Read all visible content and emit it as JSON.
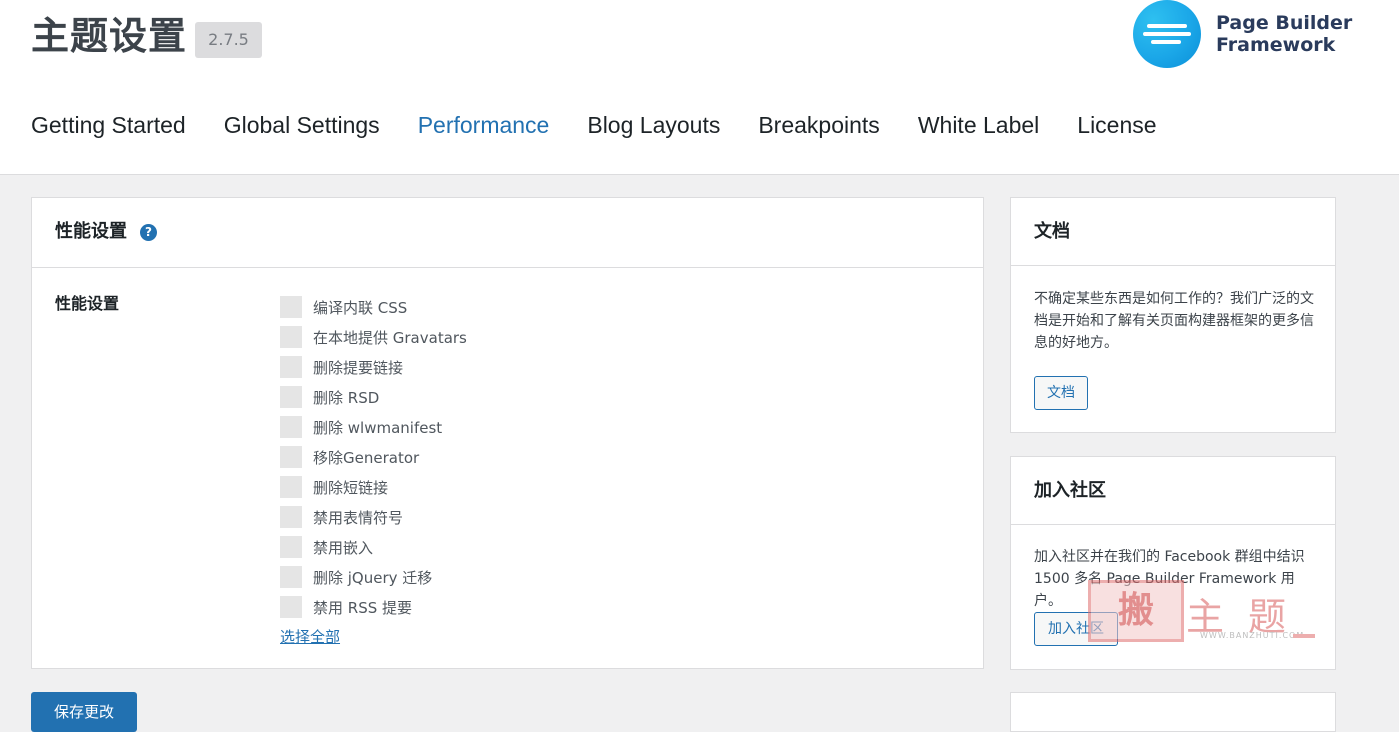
{
  "header": {
    "title": "主题设置",
    "version": "2.7.5",
    "logo": {
      "line1": "Page Builder",
      "line2": "Framework",
      "icon": "pbf-logo-icon",
      "color": "#1ba7e8"
    }
  },
  "tabs": [
    {
      "label": "Getting Started",
      "active": false
    },
    {
      "label": "Global Settings",
      "active": false
    },
    {
      "label": "Performance",
      "active": true
    },
    {
      "label": "Blog Layouts",
      "active": false
    },
    {
      "label": "Breakpoints",
      "active": false
    },
    {
      "label": "White Label",
      "active": false
    },
    {
      "label": "License",
      "active": false
    }
  ],
  "performance": {
    "title": "性能设置",
    "help_icon": "?",
    "field_label": "性能设置",
    "options": [
      {
        "label": "编译内联 CSS",
        "checked": false
      },
      {
        "label": "在本地提供 Gravatars",
        "checked": false
      },
      {
        "label": "删除提要链接",
        "checked": false
      },
      {
        "label": "删除 RSD",
        "checked": false
      },
      {
        "label": "删除 wlwmanifest",
        "checked": false
      },
      {
        "label": "移除Generator",
        "checked": false
      },
      {
        "label": "删除短链接",
        "checked": false
      },
      {
        "label": "禁用表情符号",
        "checked": false
      },
      {
        "label": "禁用嵌入",
        "checked": false
      },
      {
        "label": "删除 jQuery 迁移",
        "checked": false
      },
      {
        "label": "禁用 RSS 提要",
        "checked": false
      }
    ],
    "select_all": "选择全部",
    "save_button": "保存更改"
  },
  "sidebar": {
    "docs": {
      "title": "文档",
      "text": "不确定某些东西是如何工作的？我们广泛的文档是开始和了解有关页面构建器框架的更多信息的好地方。",
      "button": "文档"
    },
    "community": {
      "title": "加入社区",
      "text": "加入社区并在我们的 Facebook 群组中结识 1500 多名 Page Builder Framework 用户。",
      "button": "加入社区"
    }
  },
  "watermark": {
    "seal": "搬",
    "chars": "主题",
    "url": "WWW.BANZHUTI.COM"
  },
  "colors": {
    "accent": "#2271b1",
    "background": "#f0f0f1",
    "checkbox": "#e5e5e5"
  }
}
